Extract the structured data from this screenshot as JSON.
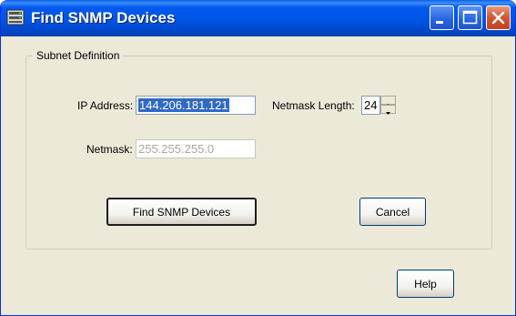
{
  "window": {
    "title": "Find SNMP Devices"
  },
  "titlebar_buttons": {
    "minimize": "minimize-icon",
    "maximize": "maximize-icon",
    "close": "close-icon"
  },
  "group": {
    "legend": "Subnet Definition"
  },
  "ip": {
    "label": "IP Address:",
    "value": "144.206.181.121"
  },
  "netmask_length": {
    "label": "Netmask Length:",
    "value": "24"
  },
  "netmask": {
    "label": "Netmask:",
    "value": "255.255.255.0"
  },
  "buttons": {
    "find": "Find SNMP Devices",
    "cancel": "Cancel",
    "help": "Help"
  }
}
